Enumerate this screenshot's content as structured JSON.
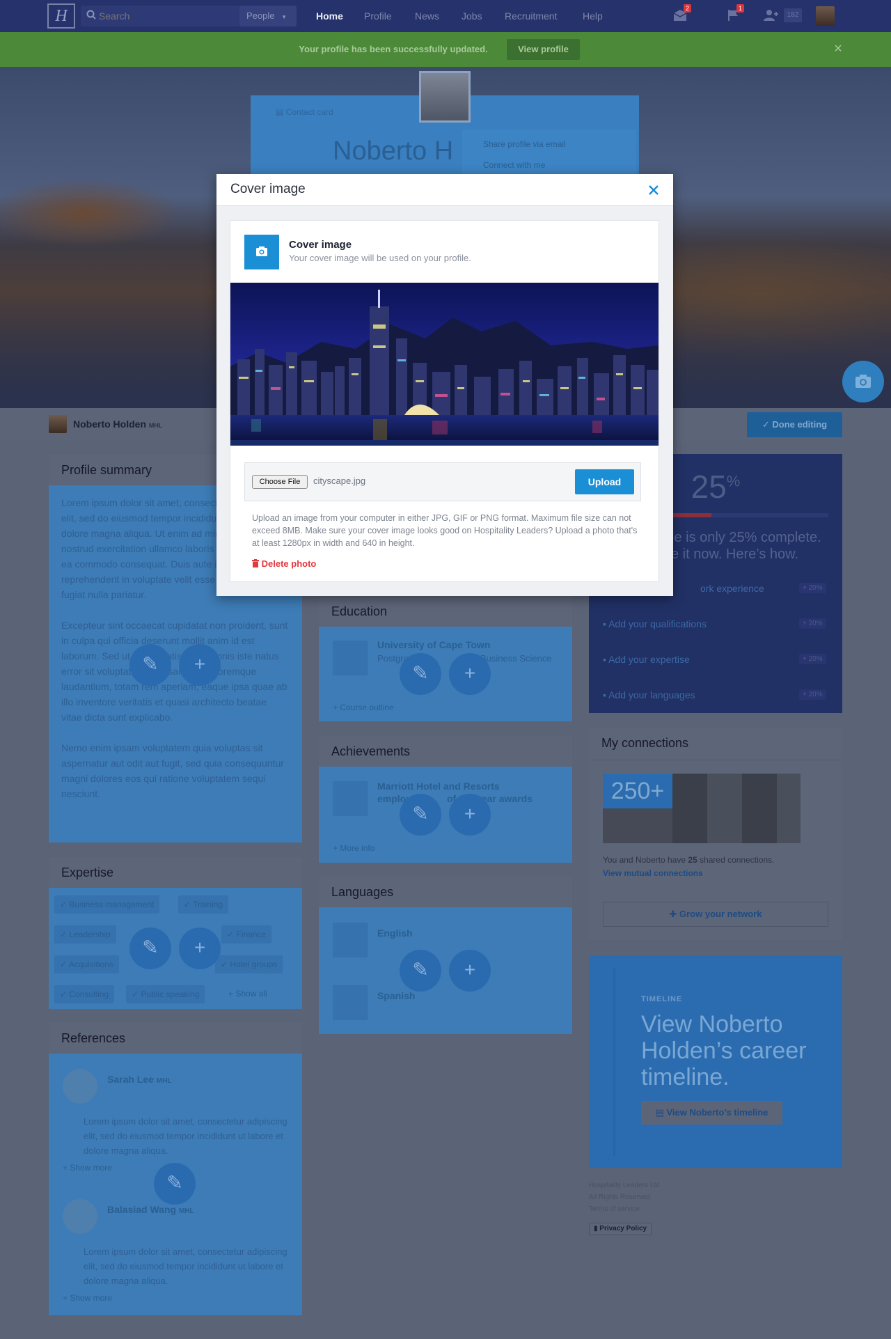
{
  "nav": {
    "logo": "H",
    "search_placeholder": "Search",
    "search_scope": "People",
    "links": [
      "Home",
      "Profile",
      "News",
      "Jobs",
      "Recruitment",
      "Help"
    ],
    "messages_badge": "2",
    "flags_badge": "1",
    "connections_count": "182"
  },
  "alert": {
    "message": "Your profile has been successfully updated.",
    "button": "View profile"
  },
  "ghost_contact_card": {
    "label": "Contact card",
    "name": "Noberto H",
    "menu_items": [
      "Share profile via email",
      "Connect with me"
    ]
  },
  "profile_bar": {
    "name": "Noberto Holden",
    "suffix": "MHL",
    "done_button": "Done editing"
  },
  "profile_summary": {
    "title": "Profile summary",
    "paragraphs": [
      "Lorem ipsum dolor sit amet, consectetur adipiscing elit, sed do eiusmod tempor incididunt ut labore et dolore magna aliqua. Ut enim ad minim veniam, quis nostrud exercitation ullamco laboris nisi ut aliquip ex ea commodo consequat. Duis aute irure dolor in reprehenderit in voluptate velit esse cillum dolore eu fugiat nulla pariatur.",
      "Excepteur sint occaecat cupidatat non proident, sunt in culpa qui officia deserunt mollit anim id est laborum. Sed ut perspiciatis unde omnis iste natus error sit voluptatem accusantium doloremque laudantium, totam rem aperiam, eaque ipsa quae ab illo inventore veritatis et quasi architecto beatae vitae dicta sunt explicabo.",
      "Nemo enim ipsam voluptatem quia voluptas sit aspernatur aut odit aut fugit, sed quia consequuntur magni dolores eos qui ratione voluptatem sequi nesciunt."
    ]
  },
  "expertise": {
    "title": "Expertise",
    "tags": [
      "Business management",
      "Training",
      "Leadership",
      "Finance",
      "Acquisitions",
      "Hotel groups",
      "Consulting",
      "Public speaking"
    ],
    "show_all": "Show all"
  },
  "references": {
    "title": "References",
    "items": [
      {
        "name": "Sarah Lee",
        "suffix": "MHL",
        "text": "Lorem ipsum dolor sit amet, consectetur adipiscing elit, sed do eiusmod tempor incididunt ut labore et dolore magna aliqua.",
        "more": "Show more"
      },
      {
        "name": "Balasiad Wang",
        "suffix": "MHL",
        "text": "Lorem ipsum dolor sit amet, consectetur adipiscing elit, sed do eiusmod tempor incididunt ut labore et dolore magna aliqua.",
        "more": "Show more"
      }
    ]
  },
  "education": {
    "title": "Education",
    "school": "University of Cape Town",
    "degree_left": "Postgraduate",
    "degree_right": "Business Science",
    "more": "Course outline"
  },
  "achievements": {
    "title": "Achievements",
    "line1": "Marriott Hotel and Resorts",
    "line2_left": "employee",
    "line2_right": "of the year awards",
    "more": "More info"
  },
  "languages": {
    "title": "Languages",
    "items": [
      "English",
      "Spanish"
    ]
  },
  "completion": {
    "percent": "25",
    "percent_sign": "%",
    "progress_fraction": 0.25,
    "line1": "le is only 25% complete.",
    "line2": "e it now. Here’s how.",
    "steps": [
      "ork experience",
      "Add your qualifications",
      "Add your expertise",
      "Add your languages"
    ],
    "step_bonus": "+ 20%"
  },
  "connections": {
    "title": "My connections",
    "count": "250+",
    "shared_prefix": "You and Noberto have",
    "shared_count": "25",
    "shared_suffix": "shared connections.",
    "mutual_link": "View mutual connections",
    "grow_button": "Grow your network"
  },
  "timeline": {
    "label": "TIMELINE",
    "headline": "View Noberto Holden’s career timeline.",
    "button": "View Noberto’s timeline"
  },
  "footer": {
    "lines": [
      "Hospitality Leaders Ltd",
      "All Rights Reserved",
      "Terms of service"
    ],
    "privacy": "Privacy Policy"
  },
  "modal": {
    "title": "Cover image",
    "panel_title": "Cover image",
    "panel_subtitle": "Your cover image will be used on your profile.",
    "choose_file": "Choose File",
    "filename": "cityscape.jpg",
    "upload": "Upload",
    "help": "Upload an image from your computer in either JPG, GIF or PNG format. Maximum file size can not exceed 8MB. Make sure your cover image looks good on Hospitality Leaders? Upload a photo that's at least 1280px in width and 640 in height.",
    "delete": "Delete photo"
  },
  "colors": {
    "accent": "#1a8fd6",
    "danger": "#e0393e",
    "nav": "#26326b",
    "success": "#4c8a3a"
  }
}
